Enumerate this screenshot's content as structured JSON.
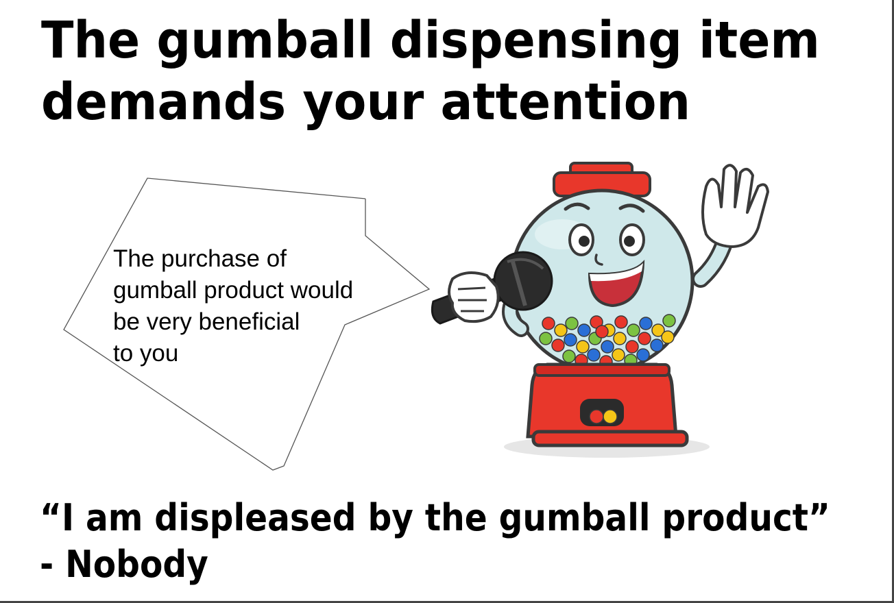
{
  "slide": {
    "title_lines": [
      "The gumball dispensing item",
      "demands your attention"
    ],
    "speech_bubble_lines": [
      "The purchase of",
      "gumball product would",
      "be very beneficial",
      "to you"
    ],
    "quote_lines": [
      "“I am displeased by the gumball product”",
      "- Nobody"
    ],
    "illustration": {
      "icon": "gumball-machine-mascot-with-microphone",
      "colors": {
        "machine_red": "#e8372b",
        "globe": "#cfe8ea",
        "outline": "#3a3a3a",
        "mic": "#2b2b2b"
      }
    }
  }
}
